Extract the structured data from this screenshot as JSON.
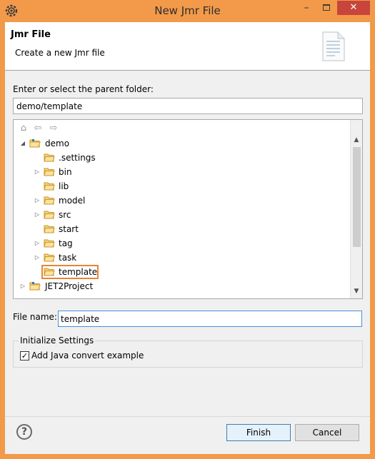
{
  "window": {
    "title": "New Jmr File",
    "minimize_glyph": "–",
    "close_glyph": "✕",
    "accent_color": "#f29a4a",
    "icon": "gear-icon"
  },
  "banner": {
    "title": "Jmr File",
    "description": "Create a new Jmr file",
    "icon": "document-icon"
  },
  "parent_folder": {
    "label": "Enter or select the parent folder:",
    "value": "demo/template"
  },
  "tree": {
    "toolbar": {
      "home": "⌂",
      "back": "⇦",
      "forward": "⇨"
    },
    "items": [
      {
        "label": "demo",
        "arrow": "◢",
        "icon": "project-icon"
      },
      {
        "label": ".settings",
        "arrow": "",
        "icon": "folder-icon"
      },
      {
        "label": "bin",
        "arrow": "▷",
        "icon": "folder-icon"
      },
      {
        "label": "lib",
        "arrow": "",
        "icon": "folder-icon"
      },
      {
        "label": "model",
        "arrow": "▷",
        "icon": "folder-icon"
      },
      {
        "label": "src",
        "arrow": "▷",
        "icon": "folder-icon"
      },
      {
        "label": "start",
        "arrow": "",
        "icon": "folder-icon"
      },
      {
        "label": "tag",
        "arrow": "▷",
        "icon": "folder-icon"
      },
      {
        "label": "task",
        "arrow": "▷",
        "icon": "folder-icon"
      },
      {
        "label": "template",
        "arrow": "",
        "icon": "folder-icon",
        "selected": true
      },
      {
        "label": "JET2Project",
        "arrow": "▷",
        "icon": "project-icon"
      }
    ],
    "scroll_up": "▲",
    "scroll_down": "▼"
  },
  "file_name": {
    "label": "File name:",
    "value": "template"
  },
  "settings": {
    "title": "Initialize Settings",
    "checkbox_label": "Add Java convert example",
    "checked": true,
    "check_glyph": "✓"
  },
  "buttons": {
    "help": "?",
    "finish": "Finish",
    "cancel": "Cancel"
  }
}
